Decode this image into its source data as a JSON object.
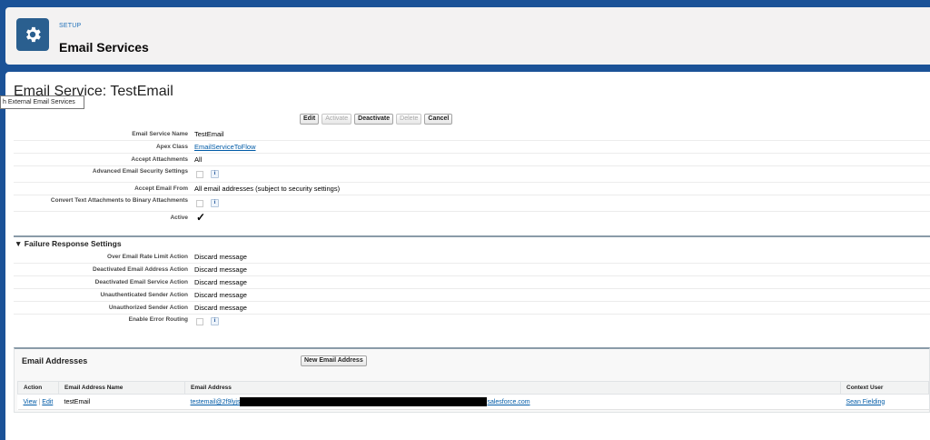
{
  "header": {
    "setup_label": "SETUP",
    "title": "Email Services"
  },
  "page": {
    "title": "Email Service: TestEmail",
    "tooltip": "h External Email Services"
  },
  "buttons": {
    "edit": "Edit",
    "activate": "Activate",
    "deactivate": "Deactivate",
    "delete": "Delete",
    "cancel": "Cancel"
  },
  "details": {
    "service_name_label": "Email Service Name",
    "service_name": "TestEmail",
    "apex_class_label": "Apex Class",
    "apex_class": "EmailServiceToFlow",
    "accept_attachments_label": "Accept Attachments",
    "accept_attachments": "All",
    "adv_security_label": "Advanced Email Security Settings",
    "accept_from_label": "Accept Email From",
    "accept_from": "All email addresses (subject to security settings)",
    "convert_text_label": "Convert Text Attachments to Binary Attachments",
    "active_label": "Active",
    "active_check": "✓"
  },
  "failure": {
    "title": "Failure Response Settings",
    "toggle": "▼",
    "rate_limit_label": "Over Email Rate Limit Action",
    "rate_limit": "Discard message",
    "deact_addr_label": "Deactivated Email Address Action",
    "deact_addr": "Discard message",
    "deact_service_label": "Deactivated Email Service Action",
    "deact_service": "Discard message",
    "unauth_label": "Unauthenticated Sender Action",
    "unauth": "Discard message",
    "unauthz_label": "Unauthorized Sender Action",
    "unauthz": "Discard message",
    "error_routing_label": "Enable Error Routing"
  },
  "email_addresses": {
    "title": "Email Addresses",
    "new_button": "New Email Address",
    "columns": [
      "Action",
      "Email Address Name",
      "Email Address",
      "Context User"
    ],
    "row": {
      "view": "View",
      "sep": "|",
      "edit": "Edit",
      "name": "testEmail",
      "email_start": "testemail@2f9lyjs",
      "email_end": "salesforce.com",
      "user": "Sean Fielding"
    }
  },
  "info_glyph": "i",
  "colors": {
    "brand_blue": "#1b5297",
    "link": "#015ba7",
    "setup_icon": "#2a5f8f"
  }
}
